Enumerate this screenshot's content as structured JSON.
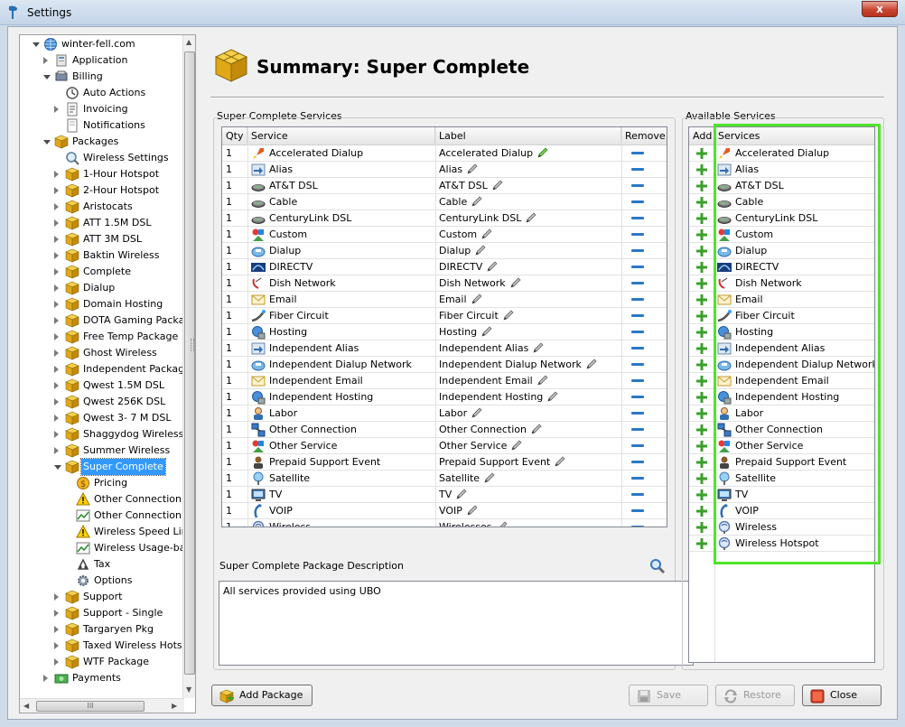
{
  "window": {
    "title": "Settings",
    "close_glyph": "x"
  },
  "tree": {
    "items": [
      {
        "label": "winter-fell.com",
        "level": 0,
        "exp": "open",
        "icon": "globe-icon"
      },
      {
        "label": "Application",
        "level": 1,
        "exp": "col",
        "icon": "app-icon"
      },
      {
        "label": "Billing",
        "level": 1,
        "exp": "open",
        "icon": "billing-icon"
      },
      {
        "label": "Auto Actions",
        "level": 2,
        "exp": "none",
        "icon": "clock-icon"
      },
      {
        "label": "Invoicing",
        "level": 2,
        "exp": "col",
        "icon": "invoice-icon"
      },
      {
        "label": "Notifications",
        "level": 2,
        "exp": "none",
        "icon": "doc-icon"
      },
      {
        "label": "Packages",
        "level": 1,
        "exp": "open",
        "icon": "package-icon"
      },
      {
        "label": "Wireless Settings",
        "level": 2,
        "exp": "none",
        "icon": "magnifier-icon"
      },
      {
        "label": "1-Hour Hotspot",
        "level": 2,
        "exp": "col",
        "icon": "package-icon"
      },
      {
        "label": "2-Hour Hotspot",
        "level": 2,
        "exp": "col",
        "icon": "package-icon"
      },
      {
        "label": "Aristocats",
        "level": 2,
        "exp": "col",
        "icon": "package-icon"
      },
      {
        "label": "ATT 1.5M DSL",
        "level": 2,
        "exp": "col",
        "icon": "package-icon"
      },
      {
        "label": "ATT 3M DSL",
        "level": 2,
        "exp": "col",
        "icon": "package-icon"
      },
      {
        "label": "Baktin Wireless",
        "level": 2,
        "exp": "col",
        "icon": "package-icon"
      },
      {
        "label": "Complete",
        "level": 2,
        "exp": "col",
        "icon": "package-icon"
      },
      {
        "label": "Dialup",
        "level": 2,
        "exp": "col",
        "icon": "package-icon"
      },
      {
        "label": "Domain Hosting",
        "level": 2,
        "exp": "col",
        "icon": "package-icon"
      },
      {
        "label": "DOTA Gaming Package",
        "level": 2,
        "exp": "col",
        "icon": "package-icon"
      },
      {
        "label": "Free Temp Package",
        "level": 2,
        "exp": "col",
        "icon": "package-icon"
      },
      {
        "label": "Ghost Wireless",
        "level": 2,
        "exp": "col",
        "icon": "package-icon"
      },
      {
        "label": "Independent Package",
        "level": 2,
        "exp": "col",
        "icon": "package-icon"
      },
      {
        "label": "Qwest 1.5M DSL",
        "level": 2,
        "exp": "col",
        "icon": "package-icon"
      },
      {
        "label": "Qwest 256K DSL",
        "level": 2,
        "exp": "col",
        "icon": "package-icon"
      },
      {
        "label": "Qwest 3- 7 M DSL",
        "level": 2,
        "exp": "col",
        "icon": "package-icon"
      },
      {
        "label": "Shaggydog Wireless",
        "level": 2,
        "exp": "col",
        "icon": "package-icon"
      },
      {
        "label": "Summer Wireless",
        "level": 2,
        "exp": "col",
        "icon": "package-icon"
      },
      {
        "label": "Super Complete",
        "level": 2,
        "exp": "open",
        "icon": "package-icon",
        "selected": true
      },
      {
        "label": "Pricing",
        "level": 3,
        "exp": "none",
        "icon": "coin-icon"
      },
      {
        "label": "Other Connection Sp",
        "level": 3,
        "exp": "none",
        "icon": "warning-icon"
      },
      {
        "label": "Other Connection Us",
        "level": 3,
        "exp": "none",
        "icon": "chart-icon"
      },
      {
        "label": "Wireless Speed Limits",
        "level": 3,
        "exp": "none",
        "icon": "warning-icon"
      },
      {
        "label": "Wireless Usage-based",
        "level": 3,
        "exp": "none",
        "icon": "chart-icon"
      },
      {
        "label": "Tax",
        "level": 3,
        "exp": "none",
        "icon": "tax-icon"
      },
      {
        "label": "Options",
        "level": 3,
        "exp": "none",
        "icon": "gear-icon"
      },
      {
        "label": "Support",
        "level": 2,
        "exp": "col",
        "icon": "package-icon"
      },
      {
        "label": "Support - Single",
        "level": 2,
        "exp": "col",
        "icon": "package-icon"
      },
      {
        "label": "Targaryen Pkg",
        "level": 2,
        "exp": "col",
        "icon": "package-icon"
      },
      {
        "label": "Taxed Wireless Hotspot",
        "level": 2,
        "exp": "col",
        "icon": "package-icon"
      },
      {
        "label": "WTF Package",
        "level": 2,
        "exp": "col",
        "icon": "package-icon"
      },
      {
        "label": "Payments",
        "level": 1,
        "exp": "col",
        "icon": "payments-icon"
      }
    ],
    "hscroll_grip": "III"
  },
  "header": {
    "title": "Summary: Super Complete"
  },
  "services_group": {
    "title": "Super Complete Services",
    "columns": [
      "Qty",
      "Service",
      "Label",
      "Remove"
    ],
    "rows": [
      {
        "qty": "1",
        "service": "Accelerated Dialup",
        "label": "Accelerated Dialup",
        "icon": "rocket"
      },
      {
        "qty": "1",
        "service": "Alias",
        "label": "Alias",
        "icon": "alias"
      },
      {
        "qty": "1",
        "service": "AT&T DSL",
        "label": "AT&T DSL",
        "icon": "modem"
      },
      {
        "qty": "1",
        "service": "Cable",
        "label": "Cable",
        "icon": "modem"
      },
      {
        "qty": "1",
        "service": "CenturyLink DSL",
        "label": "CenturyLink DSL",
        "icon": "modem"
      },
      {
        "qty": "1",
        "service": "Custom",
        "label": "Custom",
        "icon": "shapes"
      },
      {
        "qty": "1",
        "service": "Dialup",
        "label": "Dialup",
        "icon": "phone"
      },
      {
        "qty": "1",
        "service": "DIRECTV",
        "label": "DIRECTV",
        "icon": "directv"
      },
      {
        "qty": "1",
        "service": "Dish Network",
        "label": "Dish Network",
        "icon": "dish"
      },
      {
        "qty": "1",
        "service": "Email",
        "label": "Email",
        "icon": "email"
      },
      {
        "qty": "1",
        "service": "Fiber Circuit",
        "label": "Fiber Circuit",
        "icon": "fiber"
      },
      {
        "qty": "1",
        "service": "Hosting",
        "label": "Hosting",
        "icon": "hosting"
      },
      {
        "qty": "1",
        "service": "Independent Alias",
        "label": "Independent Alias",
        "icon": "alias"
      },
      {
        "qty": "1",
        "service": "Independent Dialup Network",
        "label": "Independent Dialup Network",
        "icon": "phone"
      },
      {
        "qty": "1",
        "service": "Independent Email",
        "label": "Independent Email",
        "icon": "email"
      },
      {
        "qty": "1",
        "service": "Independent Hosting",
        "label": "Independent Hosting",
        "icon": "hosting"
      },
      {
        "qty": "1",
        "service": "Labor",
        "label": "Labor",
        "icon": "person"
      },
      {
        "qty": "1",
        "service": "Other Connection",
        "label": "Other Connection",
        "icon": "network"
      },
      {
        "qty": "1",
        "service": "Other Service",
        "label": "Other Service",
        "icon": "shapes"
      },
      {
        "qty": "1",
        "service": "Prepaid Support Event",
        "label": "Prepaid Support Event",
        "icon": "support"
      },
      {
        "qty": "1",
        "service": "Satellite",
        "label": "Satellite",
        "icon": "satellite"
      },
      {
        "qty": "1",
        "service": "TV",
        "label": "TV",
        "icon": "tv"
      },
      {
        "qty": "1",
        "service": "VOIP",
        "label": "VOIP",
        "icon": "voip"
      },
      {
        "qty": "1",
        "service": "Wireless",
        "label": "Wirelesses",
        "icon": "wireless"
      }
    ]
  },
  "available_group": {
    "title": "Available Services",
    "columns": [
      "Add",
      "Services"
    ],
    "rows": [
      {
        "service": "Accelerated Dialup",
        "icon": "rocket"
      },
      {
        "service": "Alias",
        "icon": "alias"
      },
      {
        "service": "AT&T DSL",
        "icon": "modem"
      },
      {
        "service": "Cable",
        "icon": "modem"
      },
      {
        "service": "CenturyLink DSL",
        "icon": "modem"
      },
      {
        "service": "Custom",
        "icon": "shapes"
      },
      {
        "service": "Dialup",
        "icon": "phone"
      },
      {
        "service": "DIRECTV",
        "icon": "directv"
      },
      {
        "service": "Dish Network",
        "icon": "dish"
      },
      {
        "service": "Email",
        "icon": "email"
      },
      {
        "service": "Fiber Circuit",
        "icon": "fiber"
      },
      {
        "service": "Hosting",
        "icon": "hosting"
      },
      {
        "service": "Independent Alias",
        "icon": "alias"
      },
      {
        "service": "Independent Dialup Network",
        "icon": "phone"
      },
      {
        "service": "Independent Email",
        "icon": "email"
      },
      {
        "service": "Independent Hosting",
        "icon": "hosting"
      },
      {
        "service": "Labor",
        "icon": "person"
      },
      {
        "service": "Other Connection",
        "icon": "network"
      },
      {
        "service": "Other Service",
        "icon": "shapes"
      },
      {
        "service": "Prepaid Support Event",
        "icon": "support"
      },
      {
        "service": "Satellite",
        "icon": "satellite"
      },
      {
        "service": "TV",
        "icon": "tv"
      },
      {
        "service": "VOIP",
        "icon": "voip"
      },
      {
        "service": "Wireless",
        "icon": "wireless"
      },
      {
        "service": "Wireless Hotspot",
        "icon": "wireless"
      }
    ]
  },
  "description": {
    "title": "Super Complete Package Description",
    "text": "All services provided using UBO"
  },
  "buttons": {
    "add_package": "Add Package",
    "save": "Save",
    "restore": "Restore",
    "close": "Close"
  },
  "colors": {
    "highlight": "#4ee52a",
    "selection": "#3399ff",
    "remove": "#2b78c5",
    "add": "#3aa02a"
  }
}
